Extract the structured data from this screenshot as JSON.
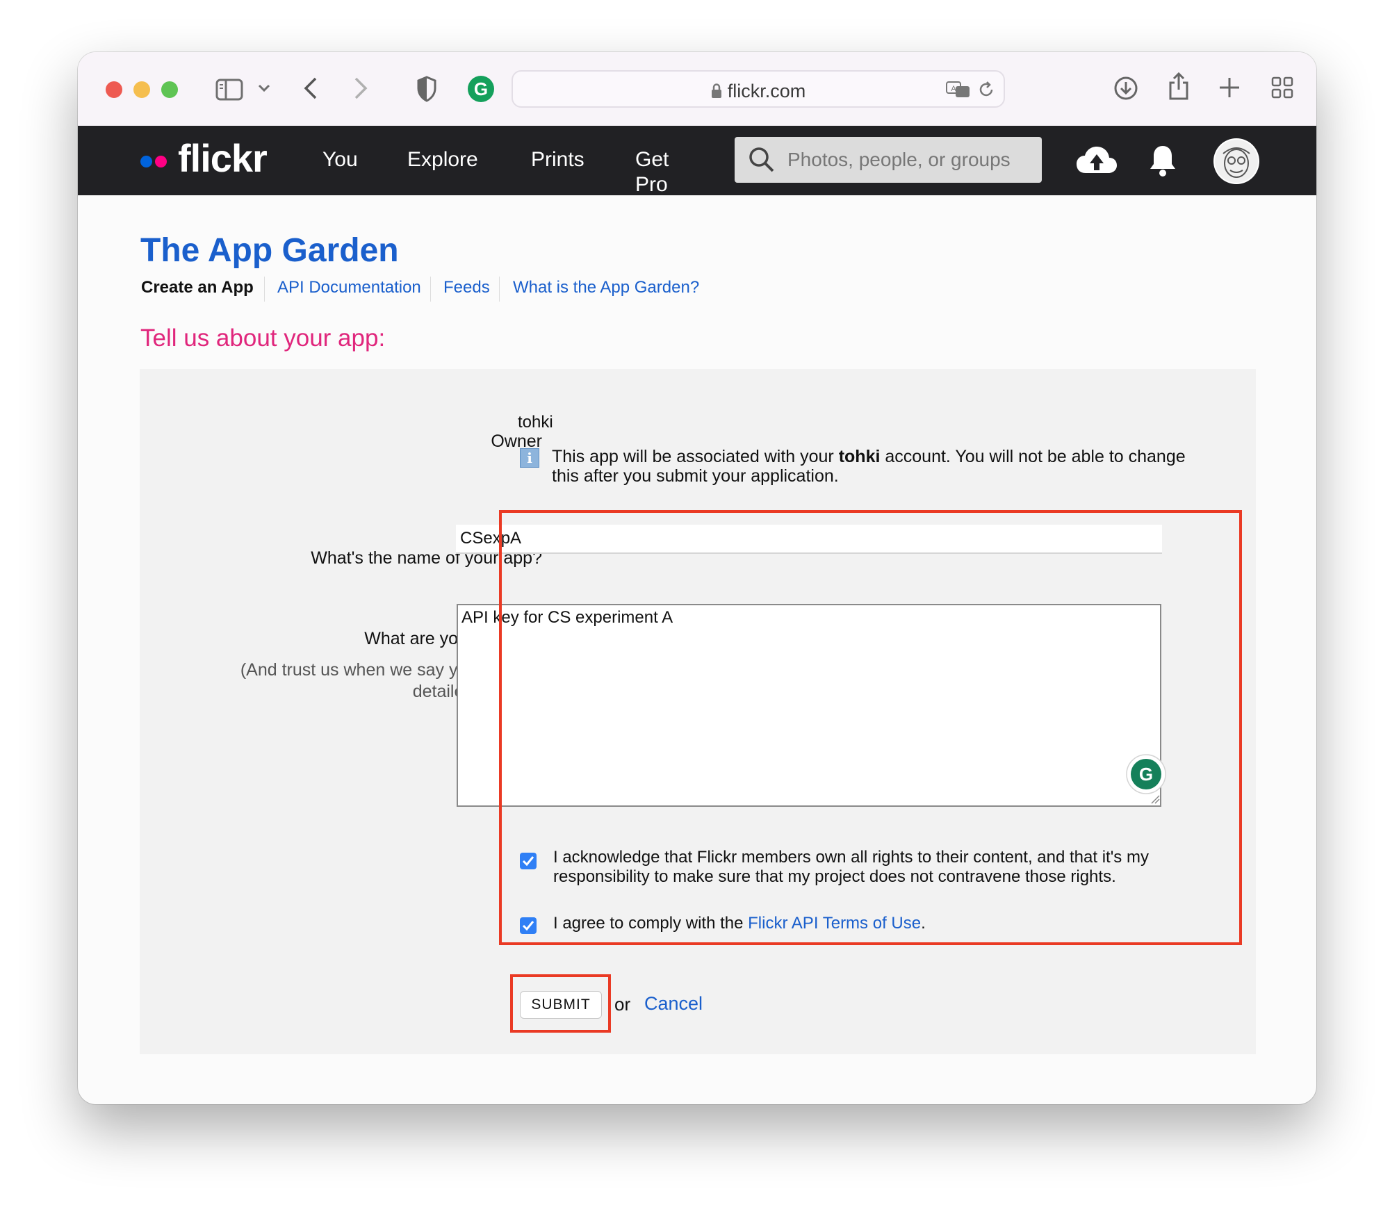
{
  "browser": {
    "url": "flickr.com"
  },
  "nav": {
    "logo": "flickr",
    "links": [
      "You",
      "Explore",
      "Prints",
      "Get",
      "Pro"
    ],
    "search_placeholder": "Photos, people, or groups"
  },
  "page": {
    "title": "The App Garden",
    "subnav": [
      "Create an App",
      "API Documentation",
      "Feeds",
      "What is the App Garden?"
    ],
    "section_title": "Tell us about your app:"
  },
  "form": {
    "owner_label": "Owner",
    "owner_name": "tohki",
    "owner_note_prefix": "This app will be associated with your ",
    "owner_note_bold": "tohki",
    "owner_note_suffix": " account. You will not be able to change",
    "owner_note_line2": "this after you submit your application.",
    "name_label": "What's the name of your app?",
    "name_value": "CSexpA",
    "building_label": "What are you building?",
    "building_hint_line1": "(And trust us when we say you can't be",
    "building_hint_line2": "detailed enough)",
    "building_value": "API key for CS experiment A",
    "ack1_line1": "I acknowledge that Flickr members own all rights to their content, and that it's my",
    "ack1_line2": "responsibility to make sure that my project does not contravene those rights.",
    "ack1_checked": true,
    "ack2_prefix": "I agree to comply with the ",
    "ack2_link": "Flickr API Terms of Use",
    "ack2_suffix": ".",
    "ack2_checked": true,
    "submit_label": "SUBMIT",
    "or_text": "or",
    "cancel_label": "Cancel"
  },
  "colors": {
    "link": "#1a5fcc",
    "section_title": "#e0267c",
    "annotation": "#ea3a24",
    "flickr_blue": "#0063dc",
    "flickr_pink": "#ff0084"
  }
}
